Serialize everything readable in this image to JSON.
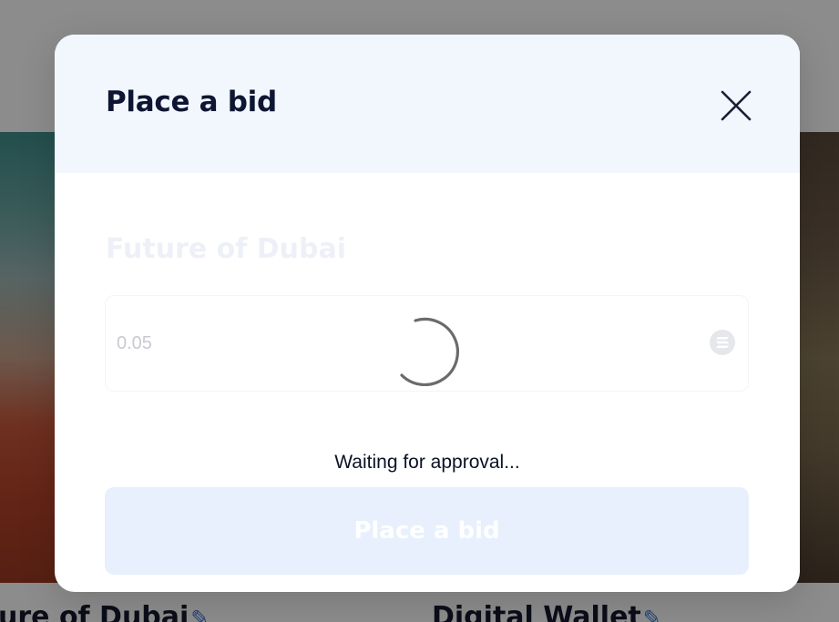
{
  "background": {
    "cards": [
      {
        "title": "ure of Dubai"
      },
      {
        "title": "Digital Wallet"
      }
    ]
  },
  "modal": {
    "title": "Place a bid",
    "close_icon": "close-icon",
    "nft_name": "Future of Dubai",
    "bid_input": {
      "value": "0.05",
      "currency_icon": "solana-icon"
    },
    "status_text": "Waiting for approval...",
    "submit_label": "Place a bid"
  },
  "colors": {
    "title_text": "#0e1633",
    "header_bg": "#f2f7fd",
    "button_disabled_bg": "#e7f0fc",
    "spinner": "#6b6b6b"
  }
}
